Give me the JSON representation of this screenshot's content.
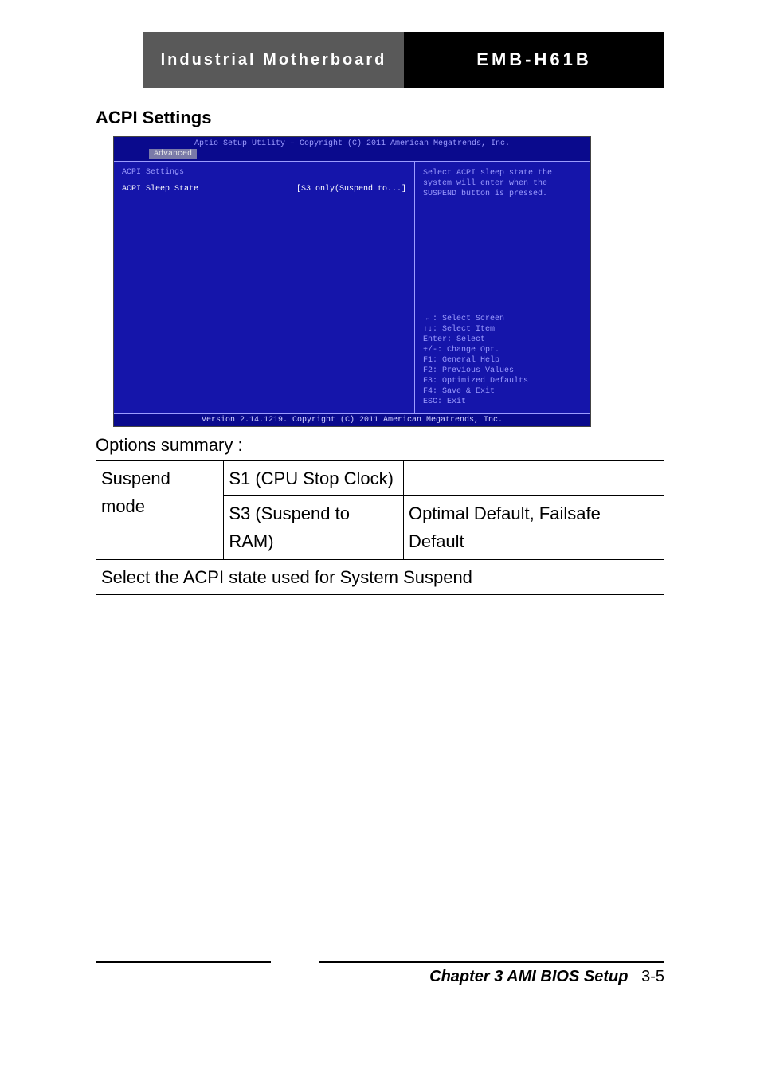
{
  "banner": {
    "left": "Industrial Motherboard",
    "right": "EMB-H61B"
  },
  "section_heading": "ACPI Settings",
  "bios": {
    "title": "Aptio Setup Utility – Copyright (C) 2011 American Megatrends, Inc.",
    "tab": "Advanced",
    "left_title": "ACPI Settings",
    "setting_label": "ACPI Sleep State",
    "setting_value": "[S3 only(Suspend to...]",
    "help_text": "Select ACPI sleep state the system will enter when the SUSPEND button is pressed.",
    "nav": {
      "l1": "→←: Select Screen",
      "l2": "↑↓: Select Item",
      "l3": "Enter: Select",
      "l4": "+/-: Change Opt.",
      "l5": "F1: General Help",
      "l6": "F2: Previous Values",
      "l7": "F3: Optimized Defaults",
      "l8": "F4: Save & Exit",
      "l9": "ESC: Exit"
    },
    "footer": "Version 2.14.1219. Copyright (C) 2011 American Megatrends, Inc."
  },
  "options_summary_label": "Options summary :",
  "table": {
    "r1c1": "Suspend mode",
    "r1c2": "S1 (CPU Stop Clock)",
    "r1c3": "",
    "r2c2": "S3 (Suspend to RAM)",
    "r2c3": "Optimal Default, Failsafe Default",
    "r3": "Select the ACPI state used for System Suspend"
  },
  "page_footer": {
    "chapter": "Chapter 3 AMI BIOS Setup",
    "page": "3-5"
  }
}
